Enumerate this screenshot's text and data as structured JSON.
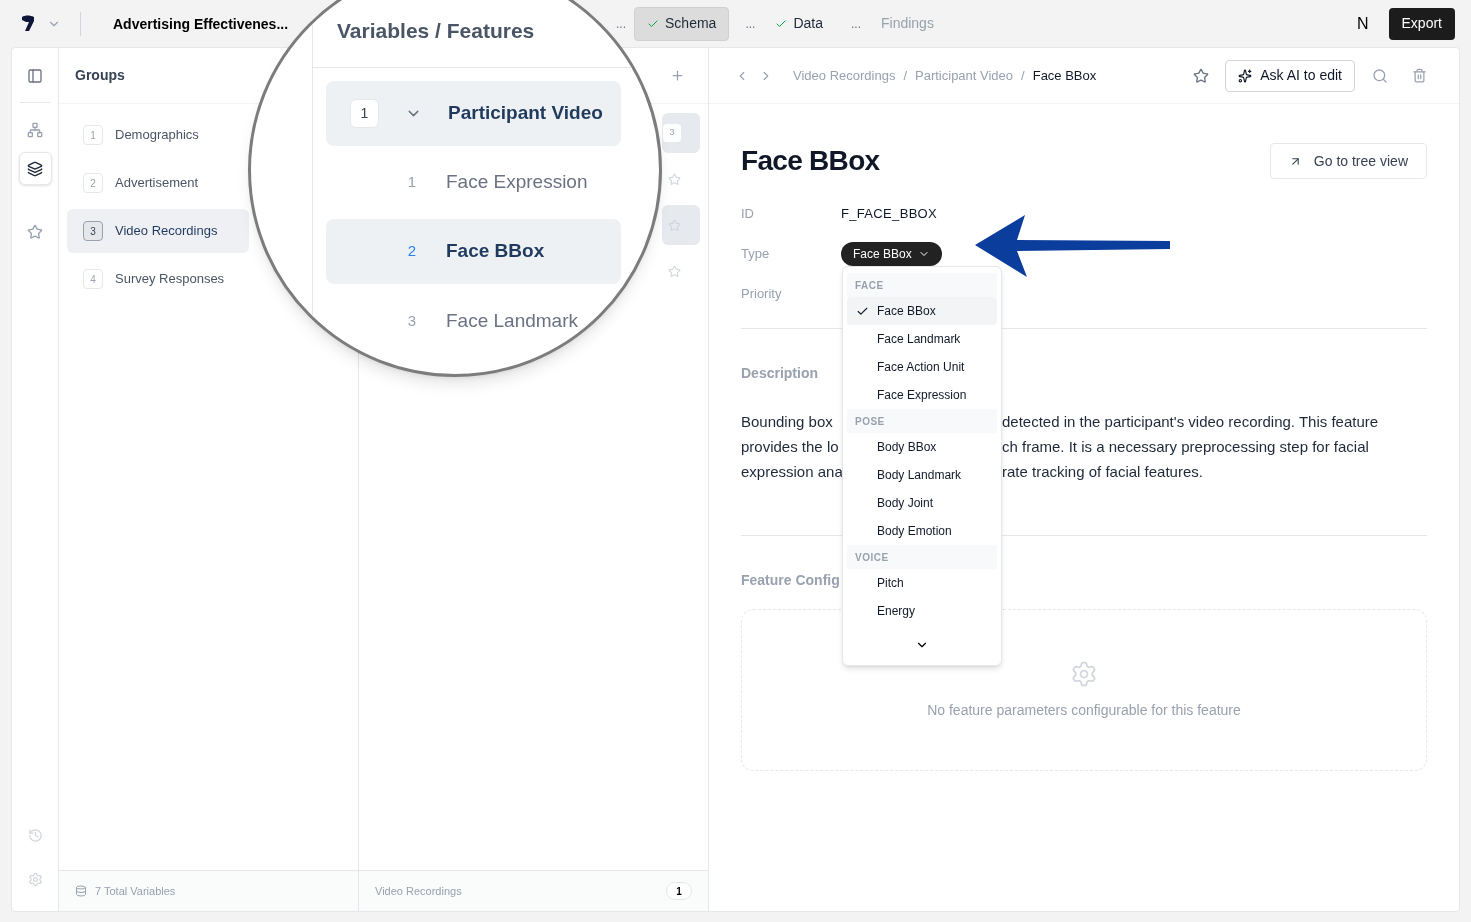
{
  "top_bar": {
    "project_title": "Advertising Effectivenes...",
    "steps": [
      {
        "separator": "...",
        "label": "Schema",
        "done": true,
        "selected": true
      },
      {
        "separator": "...",
        "label": "Data",
        "done": true,
        "selected": false
      },
      {
        "separator": "...",
        "label": "Findings",
        "done": false,
        "selected": false
      }
    ],
    "avatar": "N",
    "export_button": "Export"
  },
  "rail": {
    "items": [
      {
        "selected": false
      },
      {
        "selected": true
      },
      {
        "selected": false
      }
    ]
  },
  "groups": {
    "title": "Groups",
    "items": [
      {
        "number": "1",
        "label": "Demographics",
        "selected": false
      },
      {
        "number": "2",
        "label": "Advertisement",
        "selected": false
      },
      {
        "number": "3",
        "label": "Video Recordings",
        "selected": true
      },
      {
        "number": "4",
        "label": "Survey Responses",
        "selected": false
      }
    ],
    "footer": "7 Total Variables"
  },
  "middle": {
    "rows": [
      {
        "kind": "group",
        "count": "3",
        "selected": true
      },
      {
        "kind": "feature",
        "selected": false
      },
      {
        "kind": "feature",
        "selected": true
      },
      {
        "kind": "feature",
        "selected": false
      }
    ],
    "footer": {
      "label": "Video Recordings",
      "count": "1"
    }
  },
  "lens": {
    "title": "Variables / Features",
    "rows": [
      {
        "kind": "group",
        "number": "1",
        "label": "Participant Video",
        "expanded": true,
        "selected": true
      },
      {
        "kind": "feature",
        "number": "1",
        "label": "Face Expression",
        "selected": false
      },
      {
        "kind": "feature",
        "number": "2",
        "label": "Face BBox",
        "selected": true
      },
      {
        "kind": "feature",
        "number": "3",
        "label": "Face Landmark",
        "selected": false
      }
    ]
  },
  "detail": {
    "breadcrumb": [
      {
        "label": "Video Recordings",
        "current": false
      },
      {
        "separator": "/",
        "label": "Participant Video",
        "current": false
      },
      {
        "separator": "/",
        "label": "Face BBox",
        "current": true
      }
    ],
    "ask_ai_button": "Ask AI to edit",
    "title": "Face BBox",
    "tree_view_button": "Go to tree view",
    "fields": [
      {
        "kind": "text",
        "label": "ID",
        "value": "F_FACE_BBOX"
      },
      {
        "kind": "select",
        "label": "Type",
        "value": "Face BBox"
      },
      {
        "kind": "empty",
        "label": "Priority"
      }
    ],
    "description_label": "Description",
    "description_lines": [
      {
        "left": "Bounding box",
        "right": "detected in the participant's video recording. This feature"
      },
      {
        "left": "provides the lo",
        "right": "ch frame. It is a necessary preprocessing step for facial"
      },
      {
        "left": "expression ana",
        "right": "rate tracking of facial features."
      }
    ],
    "config_label": "Feature Config",
    "config_empty": "No feature parameters configurable for this feature"
  },
  "dropdown": {
    "sections": [
      {
        "label": "FACE",
        "items": [
          {
            "label": "Face BBox",
            "selected": true
          },
          {
            "label": "Face Landmark",
            "selected": false
          },
          {
            "label": "Face Action Unit",
            "selected": false
          },
          {
            "label": "Face Expression",
            "selected": false
          }
        ]
      },
      {
        "label": "POSE",
        "items": [
          {
            "label": "Body BBox",
            "selected": false
          },
          {
            "label": "Body Landmark",
            "selected": false
          },
          {
            "label": "Body Joint",
            "selected": false
          },
          {
            "label": "Body Emotion",
            "selected": false
          }
        ]
      },
      {
        "label": "VOICE",
        "items": [
          {
            "label": "Pitch",
            "selected": false
          },
          {
            "label": "Energy",
            "selected": false
          }
        ]
      }
    ]
  }
}
